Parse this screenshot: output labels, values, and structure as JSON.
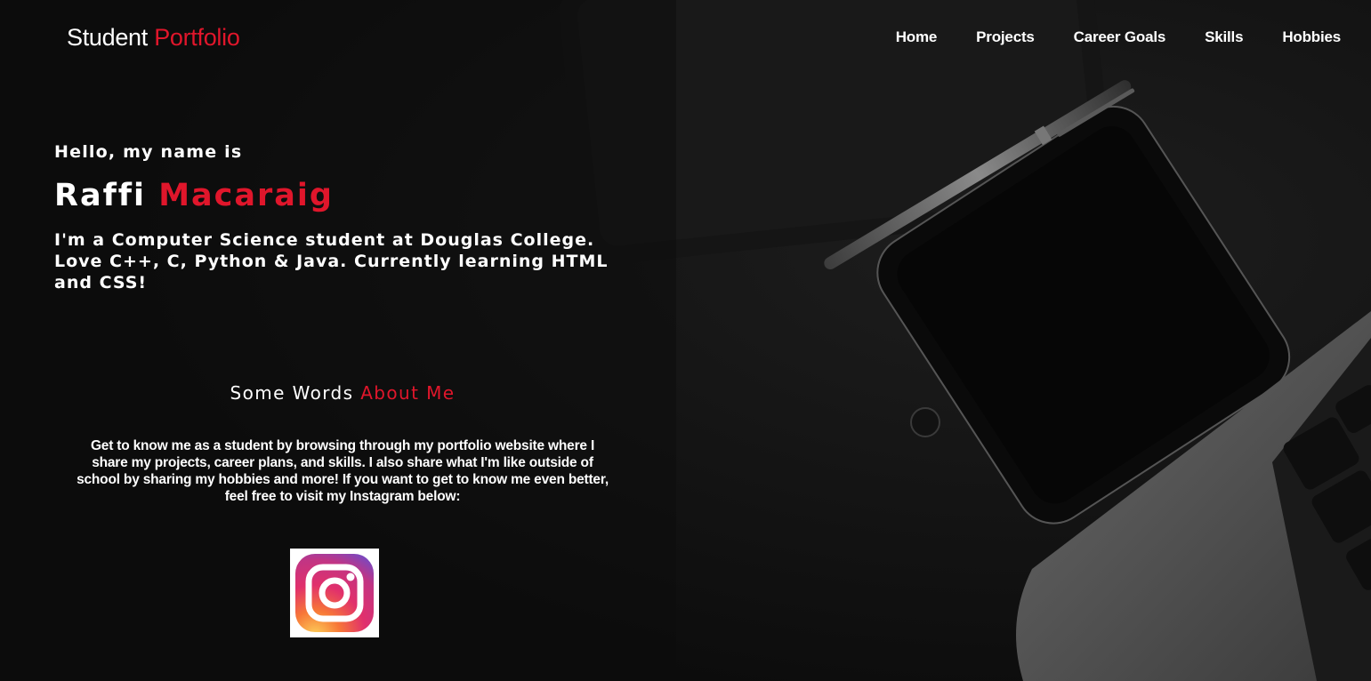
{
  "header": {
    "brand_part1": "Student ",
    "brand_part2": "Portfolio",
    "nav": [
      {
        "label": "Home"
      },
      {
        "label": "Projects"
      },
      {
        "label": "Career Goals"
      },
      {
        "label": "Skills"
      },
      {
        "label": "Hobbies"
      }
    ]
  },
  "hero": {
    "greeting": "Hello, my name is",
    "first_name": "Raffi ",
    "last_name": "Macaraig",
    "intro": "I'm a Computer Science student at Douglas College. Love C++, C, Python & Java. Currently learning HTML and CSS!"
  },
  "about": {
    "heading_part1": "Some Words ",
    "heading_part2": "About Me",
    "body": "Get to know me as a student by browsing through my portfolio website where I share my projects, career plans, and skills. I also share what I'm like outside of school by sharing my hobbies and more! If you want to get to know me even better, feel free to visit my Instagram below:"
  },
  "social": {
    "icon": "instagram-icon"
  },
  "colors": {
    "accent": "#e0162b",
    "background": "#111111",
    "text": "#ffffff"
  }
}
